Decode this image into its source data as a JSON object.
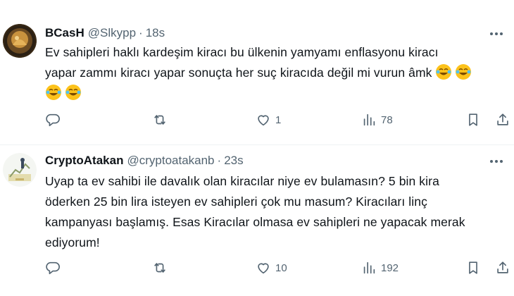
{
  "tweets": [
    {
      "author_name": "BCasH",
      "handle": "@Slkypp",
      "separator": "·",
      "time": "18s",
      "text_lines": [
        "Ev sahipleri haklı kardeşim kiracı bu ülkenin yamyamı enflasyonu kiracı",
        "yapar zammı kiracı yapar sonuçta her suç kiracıda değil mi vurun âmk"
      ],
      "emoji": "face-with-tears-of-joy",
      "stats": {
        "replies": "",
        "retweets": "",
        "likes": "1",
        "views": "78"
      }
    },
    {
      "author_name": "CryptoAtakan",
      "handle": "@cryptoatakanb",
      "separator": "·",
      "time": "23s",
      "text_lines": [
        "Uyap ta ev sahibi ile davalık olan kiracılar niye ev bulamasın? 5 bin kira",
        "öderken 25 bin lira isteyen ev sahipleri çok mu masum? Kiracıları linç",
        "kampanyası başlamış. Esas Kiracılar olmasa ev sahipleri ne yapacak merak",
        "ediyorum!"
      ],
      "stats": {
        "replies": "",
        "retweets": "",
        "likes": "10",
        "views": "192"
      }
    }
  ],
  "colors": {
    "text": "#0f1419",
    "secondary": "#536471",
    "divider": "#eff3f4",
    "emoji": "#fcc21b"
  },
  "icons": [
    "reply-icon",
    "retweet-icon",
    "like-icon",
    "views-icon",
    "bookmark-icon",
    "share-icon",
    "more-icon"
  ]
}
